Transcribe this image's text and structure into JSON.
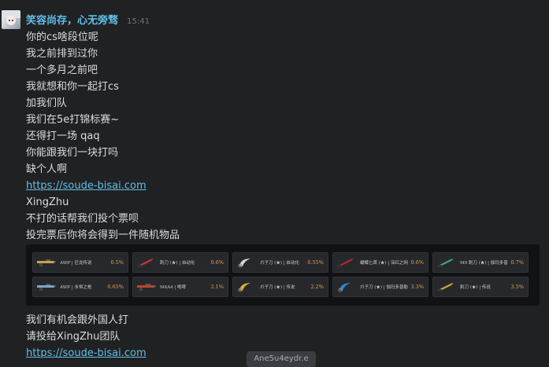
{
  "author": {
    "name": "笑容尚存，心无旁骛",
    "time": "15:41"
  },
  "messages_before": [
    {
      "text": "你的cs啥段位呢",
      "link": false
    },
    {
      "text": "我之前排到过你",
      "link": false
    },
    {
      "text": "一个多月之前吧",
      "link": false
    },
    {
      "text": "我就想和你一起打cs",
      "link": false
    },
    {
      "text": "加我们队",
      "link": false
    },
    {
      "text": "我们在5e打锦标赛~",
      "link": false
    },
    {
      "text": "还得打一场 qaq",
      "link": false
    },
    {
      "text": "你能跟我们一块打吗",
      "link": false
    },
    {
      "text": "缺个人啊",
      "link": false
    },
    {
      "text": "https://soude-bisai.com",
      "link": true
    },
    {
      "text": "XingZhu",
      "link": false
    },
    {
      "text": "不打的话帮我们投个票呗",
      "link": false
    },
    {
      "text": "投完票后你将会得到一件随机物品",
      "link": false
    }
  ],
  "embed_items": [
    [
      {
        "name": "AWP | 巨龙传说",
        "pct": "0.5%",
        "icon": "awp-rifle-icon",
        "color": "#c9a24a"
      },
      {
        "name": "刺刀 (★) | 自动化",
        "pct": "0.6%",
        "icon": "bayonet-knife-icon",
        "color": "#c8333c"
      },
      {
        "name": "爪子刀 (★) | 自动化",
        "pct": "0.55%",
        "icon": "karambit-knife-icon",
        "color": "#d9d9d9"
      },
      {
        "name": "蝴蝶匕首 (★) | 深红之网",
        "pct": "0.6%",
        "icon": "butterfly-knife-icon",
        "color": "#b32630"
      },
      {
        "name": "M9 刺刀 (★) | 伽玛多普勒",
        "pct": "0.7%",
        "icon": "m9-bayonet-icon",
        "color": "#3aa58a"
      }
    ],
    [
      {
        "name": "AWP | 永恒之枪",
        "pct": "0.65%",
        "icon": "awp-rifle-icon",
        "color": "#7ea6c7"
      },
      {
        "name": "M4A4 | 咆哮",
        "pct": "2.1%",
        "icon": "m4a4-rifle-icon",
        "color": "#b8462e"
      },
      {
        "name": "爪子刀 (★) | 传说",
        "pct": "2.2%",
        "icon": "karambit-knife-icon",
        "color": "#d8b23a"
      },
      {
        "name": "爪子刀 (★) | 伽玛多普勒",
        "pct": "3.3%",
        "icon": "karambit-knife-icon",
        "color": "#2f86c9"
      },
      {
        "name": "刺刀 (★) | 传说",
        "pct": "3.5%",
        "icon": "bayonet-knife-icon",
        "color": "#caa53a"
      }
    ]
  ],
  "messages_after": [
    {
      "text": "我们有机会跟外国人打",
      "link": false
    },
    {
      "text": "请投给XingZhu团队",
      "link": false
    },
    {
      "text": "https://soude-bisai.com",
      "link": true
    }
  ],
  "tooltip": "Ane5u4eydr.e"
}
